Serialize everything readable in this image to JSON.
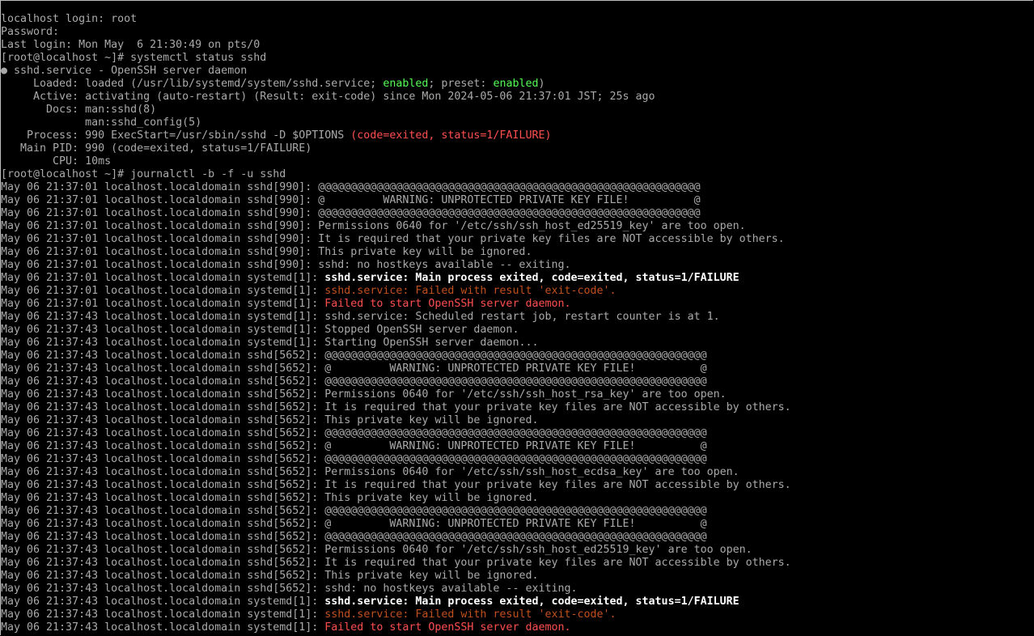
{
  "colors": {
    "gray": "#aaaaaa",
    "white": "#ffffff",
    "orange": "#c1501c",
    "red": "#ff4f4f",
    "green": "#55ff55",
    "background": "#000000"
  },
  "lines": [
    {
      "segs": [
        {
          "t": "localhost login: root",
          "s": "gray"
        }
      ]
    },
    {
      "segs": [
        {
          "t": "Password:",
          "s": "gray"
        }
      ]
    },
    {
      "segs": [
        {
          "t": "Last login: Mon May  6 21:30:49 on pts/0",
          "s": "gray"
        }
      ]
    },
    {
      "segs": [
        {
          "t": "[root@localhost ~]# systemctl status sshd",
          "s": "gray"
        }
      ]
    },
    {
      "segs": [
        {
          "t": "● sshd.service - OpenSSH server daemon",
          "s": "gray"
        }
      ]
    },
    {
      "segs": [
        {
          "t": "     Loaded: loaded (/usr/lib/systemd/system/sshd.service; ",
          "s": "gray"
        },
        {
          "t": "enabled",
          "s": "green"
        },
        {
          "t": "; preset: ",
          "s": "gray"
        },
        {
          "t": "enabled",
          "s": "green"
        },
        {
          "t": ")",
          "s": "gray"
        }
      ]
    },
    {
      "segs": [
        {
          "t": "     Active: activating (auto-restart) (Result: exit-code) since Mon 2024-05-06 21:37:01 JST; 25s ago",
          "s": "gray"
        }
      ]
    },
    {
      "segs": [
        {
          "t": "       Docs: man:sshd(8)",
          "s": "gray"
        }
      ]
    },
    {
      "segs": [
        {
          "t": "             man:sshd_config(5)",
          "s": "gray"
        }
      ]
    },
    {
      "segs": [
        {
          "t": "    Process: 990 ExecStart=/usr/sbin/sshd -D $OPTIONS ",
          "s": "gray"
        },
        {
          "t": "(code=exited, status=1/FAILURE)",
          "s": "red"
        }
      ]
    },
    {
      "segs": [
        {
          "t": "   Main PID: 990 (code=exited, status=1/FAILURE)",
          "s": "gray"
        }
      ]
    },
    {
      "segs": [
        {
          "t": "        CPU: 10ms",
          "s": "gray"
        }
      ]
    },
    {
      "segs": [
        {
          "t": "[root@localhost ~]# journalctl -b -f -u sshd",
          "s": "gray"
        }
      ]
    },
    {
      "segs": [
        {
          "t": "May 06 21:37:01 localhost.localdomain sshd[990]: ",
          "s": "gray"
        },
        {
          "t": "@@@@@@@@@@@@@@@@@@@@@@@@@@@@@@@@@@@@@@@@@@@@@@@@@@@@@@@@@@@",
          "s": "gray"
        }
      ]
    },
    {
      "segs": [
        {
          "t": "May 06 21:37:01 localhost.localdomain sshd[990]: ",
          "s": "gray"
        },
        {
          "t": "@         WARNING: UNPROTECTED PRIVATE KEY FILE!          @",
          "s": "gray"
        }
      ]
    },
    {
      "segs": [
        {
          "t": "May 06 21:37:01 localhost.localdomain sshd[990]: ",
          "s": "gray"
        },
        {
          "t": "@@@@@@@@@@@@@@@@@@@@@@@@@@@@@@@@@@@@@@@@@@@@@@@@@@@@@@@@@@@",
          "s": "gray"
        }
      ]
    },
    {
      "segs": [
        {
          "t": "May 06 21:37:01 localhost.localdomain sshd[990]: ",
          "s": "gray"
        },
        {
          "t": "Permissions 0640 for '/etc/ssh/ssh_host_ed25519_key' are too open.",
          "s": "gray"
        }
      ]
    },
    {
      "segs": [
        {
          "t": "May 06 21:37:01 localhost.localdomain sshd[990]: ",
          "s": "gray"
        },
        {
          "t": "It is required that your private key files are NOT accessible by others.",
          "s": "gray"
        }
      ]
    },
    {
      "segs": [
        {
          "t": "May 06 21:37:01 localhost.localdomain sshd[990]: ",
          "s": "gray"
        },
        {
          "t": "This private key will be ignored.",
          "s": "gray"
        }
      ]
    },
    {
      "segs": [
        {
          "t": "May 06 21:37:01 localhost.localdomain sshd[990]: ",
          "s": "gray"
        },
        {
          "t": "sshd: no hostkeys available -- exiting.",
          "s": "gray"
        }
      ]
    },
    {
      "segs": [
        {
          "t": "May 06 21:37:01 localhost.localdomain systemd[1]: ",
          "s": "gray"
        },
        {
          "t": "sshd.service: Main process exited, code=exited, status=1/FAILURE",
          "s": "white"
        }
      ]
    },
    {
      "segs": [
        {
          "t": "May 06 21:37:01 localhost.localdomain systemd[1]: ",
          "s": "gray"
        },
        {
          "t": "sshd.service: Failed with result 'exit-code'.",
          "s": "orange"
        }
      ]
    },
    {
      "segs": [
        {
          "t": "May 06 21:37:01 localhost.localdomain systemd[1]: ",
          "s": "gray"
        },
        {
          "t": "Failed to start OpenSSH server daemon.",
          "s": "red"
        }
      ]
    },
    {
      "segs": [
        {
          "t": "May 06 21:37:43 localhost.localdomain systemd[1]: ",
          "s": "gray"
        },
        {
          "t": "sshd.service: Scheduled restart job, restart counter is at 1.",
          "s": "gray"
        }
      ]
    },
    {
      "segs": [
        {
          "t": "May 06 21:37:43 localhost.localdomain systemd[1]: ",
          "s": "gray"
        },
        {
          "t": "Stopped OpenSSH server daemon.",
          "s": "gray"
        }
      ]
    },
    {
      "segs": [
        {
          "t": "May 06 21:37:43 localhost.localdomain systemd[1]: ",
          "s": "gray"
        },
        {
          "t": "Starting OpenSSH server daemon...",
          "s": "gray"
        }
      ]
    },
    {
      "segs": [
        {
          "t": "May 06 21:37:43 localhost.localdomain sshd[5652]: ",
          "s": "gray"
        },
        {
          "t": "@@@@@@@@@@@@@@@@@@@@@@@@@@@@@@@@@@@@@@@@@@@@@@@@@@@@@@@@@@@",
          "s": "gray"
        }
      ]
    },
    {
      "segs": [
        {
          "t": "May 06 21:37:43 localhost.localdomain sshd[5652]: ",
          "s": "gray"
        },
        {
          "t": "@         WARNING: UNPROTECTED PRIVATE KEY FILE!          @",
          "s": "gray"
        }
      ]
    },
    {
      "segs": [
        {
          "t": "May 06 21:37:43 localhost.localdomain sshd[5652]: ",
          "s": "gray"
        },
        {
          "t": "@@@@@@@@@@@@@@@@@@@@@@@@@@@@@@@@@@@@@@@@@@@@@@@@@@@@@@@@@@@",
          "s": "gray"
        }
      ]
    },
    {
      "segs": [
        {
          "t": "May 06 21:37:43 localhost.localdomain sshd[5652]: ",
          "s": "gray"
        },
        {
          "t": "Permissions 0640 for '/etc/ssh/ssh_host_rsa_key' are too open.",
          "s": "gray"
        }
      ]
    },
    {
      "segs": [
        {
          "t": "May 06 21:37:43 localhost.localdomain sshd[5652]: ",
          "s": "gray"
        },
        {
          "t": "It is required that your private key files are NOT accessible by others.",
          "s": "gray"
        }
      ]
    },
    {
      "segs": [
        {
          "t": "May 06 21:37:43 localhost.localdomain sshd[5652]: ",
          "s": "gray"
        },
        {
          "t": "This private key will be ignored.",
          "s": "gray"
        }
      ]
    },
    {
      "segs": [
        {
          "t": "May 06 21:37:43 localhost.localdomain sshd[5652]: ",
          "s": "gray"
        },
        {
          "t": "@@@@@@@@@@@@@@@@@@@@@@@@@@@@@@@@@@@@@@@@@@@@@@@@@@@@@@@@@@@",
          "s": "gray"
        }
      ]
    },
    {
      "segs": [
        {
          "t": "May 06 21:37:43 localhost.localdomain sshd[5652]: ",
          "s": "gray"
        },
        {
          "t": "@         WARNING: UNPROTECTED PRIVATE KEY FILE!          @",
          "s": "gray"
        }
      ]
    },
    {
      "segs": [
        {
          "t": "May 06 21:37:43 localhost.localdomain sshd[5652]: ",
          "s": "gray"
        },
        {
          "t": "@@@@@@@@@@@@@@@@@@@@@@@@@@@@@@@@@@@@@@@@@@@@@@@@@@@@@@@@@@@",
          "s": "gray"
        }
      ]
    },
    {
      "segs": [
        {
          "t": "May 06 21:37:43 localhost.localdomain sshd[5652]: ",
          "s": "gray"
        },
        {
          "t": "Permissions 0640 for '/etc/ssh/ssh_host_ecdsa_key' are too open.",
          "s": "gray"
        }
      ]
    },
    {
      "segs": [
        {
          "t": "May 06 21:37:43 localhost.localdomain sshd[5652]: ",
          "s": "gray"
        },
        {
          "t": "It is required that your private key files are NOT accessible by others.",
          "s": "gray"
        }
      ]
    },
    {
      "segs": [
        {
          "t": "May 06 21:37:43 localhost.localdomain sshd[5652]: ",
          "s": "gray"
        },
        {
          "t": "This private key will be ignored.",
          "s": "gray"
        }
      ]
    },
    {
      "segs": [
        {
          "t": "May 06 21:37:43 localhost.localdomain sshd[5652]: ",
          "s": "gray"
        },
        {
          "t": "@@@@@@@@@@@@@@@@@@@@@@@@@@@@@@@@@@@@@@@@@@@@@@@@@@@@@@@@@@@",
          "s": "gray"
        }
      ]
    },
    {
      "segs": [
        {
          "t": "May 06 21:37:43 localhost.localdomain sshd[5652]: ",
          "s": "gray"
        },
        {
          "t": "@         WARNING: UNPROTECTED PRIVATE KEY FILE!          @",
          "s": "gray"
        }
      ]
    },
    {
      "segs": [
        {
          "t": "May 06 21:37:43 localhost.localdomain sshd[5652]: ",
          "s": "gray"
        },
        {
          "t": "@@@@@@@@@@@@@@@@@@@@@@@@@@@@@@@@@@@@@@@@@@@@@@@@@@@@@@@@@@@",
          "s": "gray"
        }
      ]
    },
    {
      "segs": [
        {
          "t": "May 06 21:37:43 localhost.localdomain sshd[5652]: ",
          "s": "gray"
        },
        {
          "t": "Permissions 0640 for '/etc/ssh/ssh_host_ed25519_key' are too open.",
          "s": "gray"
        }
      ]
    },
    {
      "segs": [
        {
          "t": "May 06 21:37:43 localhost.localdomain sshd[5652]: ",
          "s": "gray"
        },
        {
          "t": "It is required that your private key files are NOT accessible by others.",
          "s": "gray"
        }
      ]
    },
    {
      "segs": [
        {
          "t": "May 06 21:37:43 localhost.localdomain sshd[5652]: ",
          "s": "gray"
        },
        {
          "t": "This private key will be ignored.",
          "s": "gray"
        }
      ]
    },
    {
      "segs": [
        {
          "t": "May 06 21:37:43 localhost.localdomain sshd[5652]: ",
          "s": "gray"
        },
        {
          "t": "sshd: no hostkeys available -- exiting.",
          "s": "gray"
        }
      ]
    },
    {
      "segs": [
        {
          "t": "May 06 21:37:43 localhost.localdomain systemd[1]: ",
          "s": "gray"
        },
        {
          "t": "sshd.service: Main process exited, code=exited, status=1/FAILURE",
          "s": "white"
        }
      ]
    },
    {
      "segs": [
        {
          "t": "May 06 21:37:43 localhost.localdomain systemd[1]: ",
          "s": "gray"
        },
        {
          "t": "sshd.service: Failed with result 'exit-code'.",
          "s": "orange"
        }
      ]
    },
    {
      "segs": [
        {
          "t": "May 06 21:37:43 localhost.localdomain systemd[1]: ",
          "s": "gray"
        },
        {
          "t": "Failed to start OpenSSH server daemon.",
          "s": "red"
        }
      ]
    }
  ]
}
